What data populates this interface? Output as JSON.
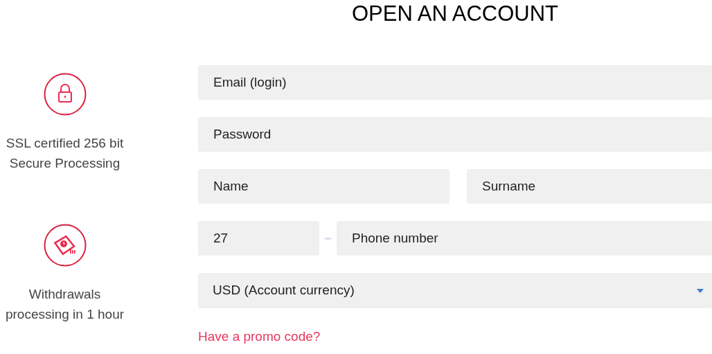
{
  "title": "OPEN AN ACCOUNT",
  "features": [
    {
      "kind": "lock",
      "text": "SSL certified 256 bit Secure Processing"
    },
    {
      "kind": "withdrawal",
      "text": "Withdrawals processing in 1 hour"
    }
  ],
  "form": {
    "email": {
      "placeholder": "Email (login)"
    },
    "password": {
      "placeholder": "Password"
    },
    "name": {
      "placeholder": "Name"
    },
    "surname": {
      "placeholder": "Surname"
    },
    "phone_code": {
      "value": "27"
    },
    "phone": {
      "placeholder": "Phone number"
    },
    "currency": {
      "value": "USD (Account currency)"
    }
  },
  "promo_link": "Have a promo code?"
}
